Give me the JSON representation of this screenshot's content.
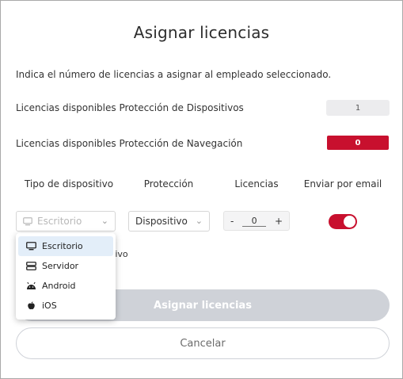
{
  "dialog": {
    "title": "Asignar licencias",
    "description": "Indica el número de licencias a asignar al empleado seleccionado.",
    "devices_label": "Licencias disponibles Protección de Dispositivos",
    "devices_count": "1",
    "navigation_label": "Licencias disponibles Protección de Navegación",
    "navigation_count": "0"
  },
  "columns": {
    "device_type": "Tipo de dispositivo",
    "protection": "Protección",
    "licenses": "Licencias",
    "email": "Enviar por email"
  },
  "form": {
    "device_select_value": "Escritorio",
    "protection_select_value": "Dispositivo",
    "stepper_minus": "-",
    "stepper_value": "0",
    "stepper_plus": "+",
    "email_toggle_on": true,
    "partial_hidden_text": "tivo"
  },
  "dropdown": {
    "items": [
      {
        "label": "Escritorio",
        "icon": "desktop-icon",
        "selected": true
      },
      {
        "label": "Servidor",
        "icon": "server-icon",
        "selected": false
      },
      {
        "label": "Android",
        "icon": "android-icon",
        "selected": false
      },
      {
        "label": "iOS",
        "icon": "apple-icon",
        "selected": false
      }
    ]
  },
  "buttons": {
    "assign": "Asignar licencias",
    "cancel": "Cancelar"
  },
  "colors": {
    "accent_red": "#c8102e",
    "disabled_button": "#cfd2d8",
    "selected_item": "#e3eef9"
  }
}
